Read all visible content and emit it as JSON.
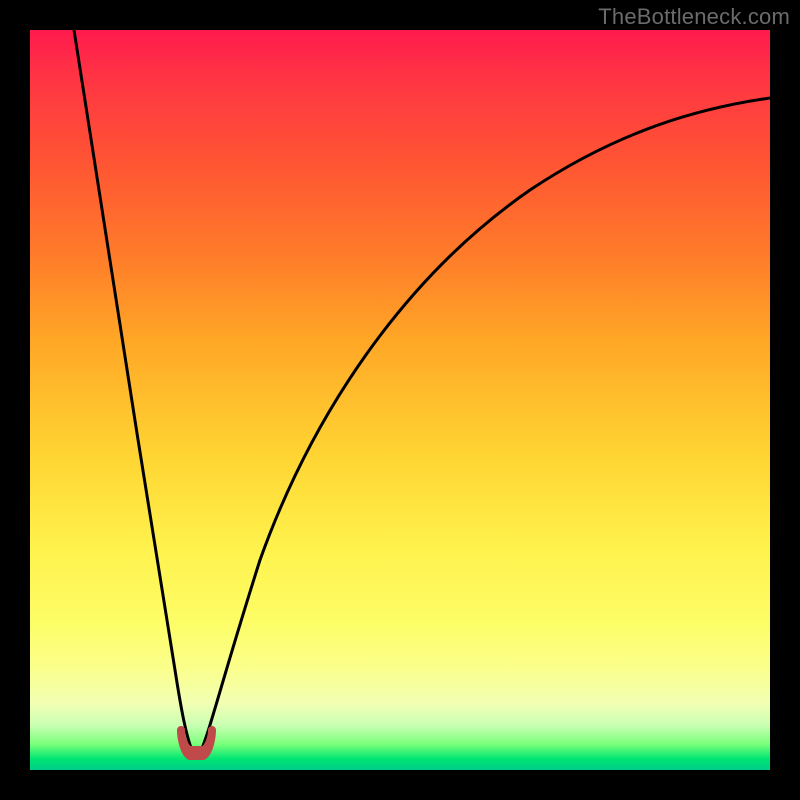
{
  "watermark": "TheBottleneck.com",
  "colors": {
    "frame": "#000000",
    "gradient_top": "#ff1a4d",
    "gradient_mid": "#ffd633",
    "gradient_bottom": "#00cc88",
    "curve": "#000000",
    "marker": "#c04a4a"
  },
  "chart_data": {
    "type": "line",
    "title": "",
    "xlabel": "",
    "ylabel": "",
    "xlim": [
      0,
      100
    ],
    "ylim": [
      0,
      100
    ],
    "grid": false,
    "legend": false,
    "optimum_x": 22,
    "series": [
      {
        "name": "left-branch",
        "x": [
          6,
          8,
          10,
          12,
          14,
          16,
          18,
          20,
          21,
          22
        ],
        "y": [
          100,
          84,
          70,
          56,
          43,
          31,
          20,
          10,
          5,
          2
        ]
      },
      {
        "name": "right-branch",
        "x": [
          22,
          24,
          26,
          28,
          31,
          35,
          40,
          46,
          54,
          63,
          74,
          86,
          100
        ],
        "y": [
          2,
          10,
          22,
          32,
          43,
          53,
          62,
          69,
          75,
          80,
          84,
          87,
          89
        ]
      },
      {
        "name": "optimum-marker",
        "x": [
          20.5,
          21,
          21.5,
          22,
          22.5,
          23,
          23.5
        ],
        "y": [
          5.5,
          3.5,
          2.3,
          2,
          2.3,
          3.5,
          5.5
        ]
      }
    ]
  }
}
